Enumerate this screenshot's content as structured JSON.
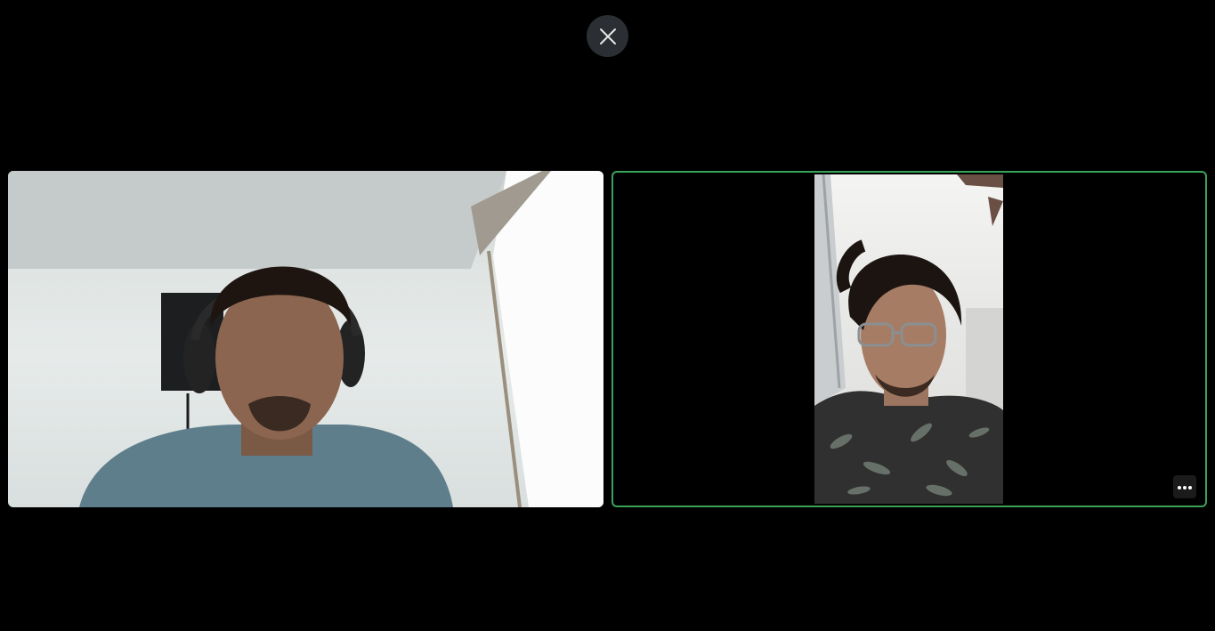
{
  "controls": {
    "close_icon": "close-icon",
    "more_icon": "more-options-icon"
  },
  "participants": [
    {
      "video": "webcam-video",
      "active_speaker": false
    },
    {
      "video": "webcam-video",
      "active_speaker": true
    }
  ],
  "colors": {
    "background": "#000000",
    "close_button_bg": "#2b2f33",
    "active_speaker_border": "#3aa35a"
  }
}
